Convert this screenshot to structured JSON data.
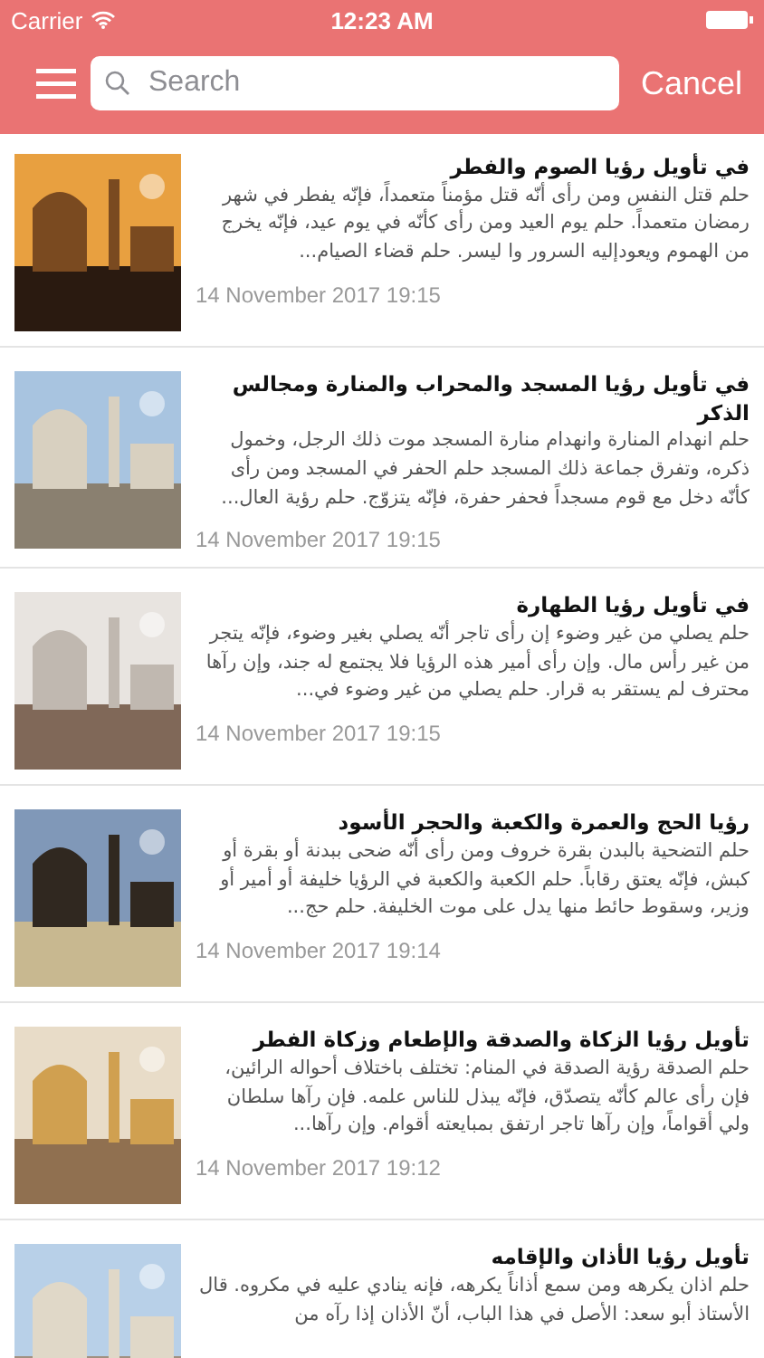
{
  "status_bar": {
    "carrier": "Carrier",
    "time": "12:23 AM"
  },
  "search": {
    "placeholder": "Search",
    "cancel": "Cancel"
  },
  "articles": [
    {
      "title": "في تأويل رؤيا الصوم والفطر",
      "excerpt": "حلم قتل النفس ومن رأى أنّه قتل مؤمناً متعمداً، فإنّه يفطر في شهر رمضان متعمداً.   حلم يوم العيد  ومن رأى كأنّه في يوم عيد، فإنّه يخرج من الهموم ويعودإليه السرور وا ليسر.   حلم قضاء الصيام...",
      "date": "14 November 2017 19:15"
    },
    {
      "title": "في تأويل رؤيا المسجد والمحراب والمنارة ومجالس الذكر",
      "excerpt": "حلم انهدام المنارة  وانهدام منارة المسجد موت ذلك الرجل، وخمول ذكره، وتفرق جماعة ذلك المسجد  حلم الحفر في المسجد  ومن رأى كأنّه دخل مع قوم مسجداً فحفر حفرة، فإنّه يتزوّج.  حلم رؤية العال...",
      "date": "14 November 2017 19:15"
    },
    {
      "title": "في تأويل رؤيا الطهارة",
      "excerpt": "حلم يصلي من غير وضوء  إن رأى تاجر أنّه يصلي بغير وضوء، فإنّه يتجر من غير رأس مال. وإن رأى أمير هذه الرؤيا فلا يجتمع له جند، وإن رآها محترف لم يستقر به قرار.  حلم يصلي من غير وضوء في...",
      "date": "14 November 2017 19:15"
    },
    {
      "title": "رؤيا الحج والعمرة والكعبة والحجر الأسود",
      "excerpt": "حلم التضحية بالبدن بقرة خروف  ومن رأى أنّه ضحى ببدنة أو بقرة أو كبش، فإنّه يعتق رقاباً.  حلم الكعبة  والكعبة في الرؤيا خليفة أو أمير أو وزير، وسقوط حائط منها يدل على موت الخليفة.  حلم حج...",
      "date": "14 November 2017 19:14"
    },
    {
      "title": "تأويل رؤيا الزكاة والصدقة والإطعام وزكاة الفطر",
      "excerpt": "حلم الصدقة  رؤية الصدقة في المنام: تختلف باختلاف أحواله الرائين، فإن رأى عالم كأنّه يتصدّق، فإنّه يبذل للناس علمه. فإن رآها سلطان ولي أقواماً، وإن رآها تاجر ارتفق بمبايعته أقوام. وإن رآها...",
      "date": "14 November 2017 19:12"
    },
    {
      "title": "تأويل رؤيا الأذان والإقامه",
      "excerpt": "حلم اذان يكرهه  ومن سمع أذاناً يكرهه، فإنه ينادي عليه في مكروه. قال الأستاذ أبو سعد: الأصل في هذا الباب، أنّ الأذان إذا رآه من"
    }
  ]
}
